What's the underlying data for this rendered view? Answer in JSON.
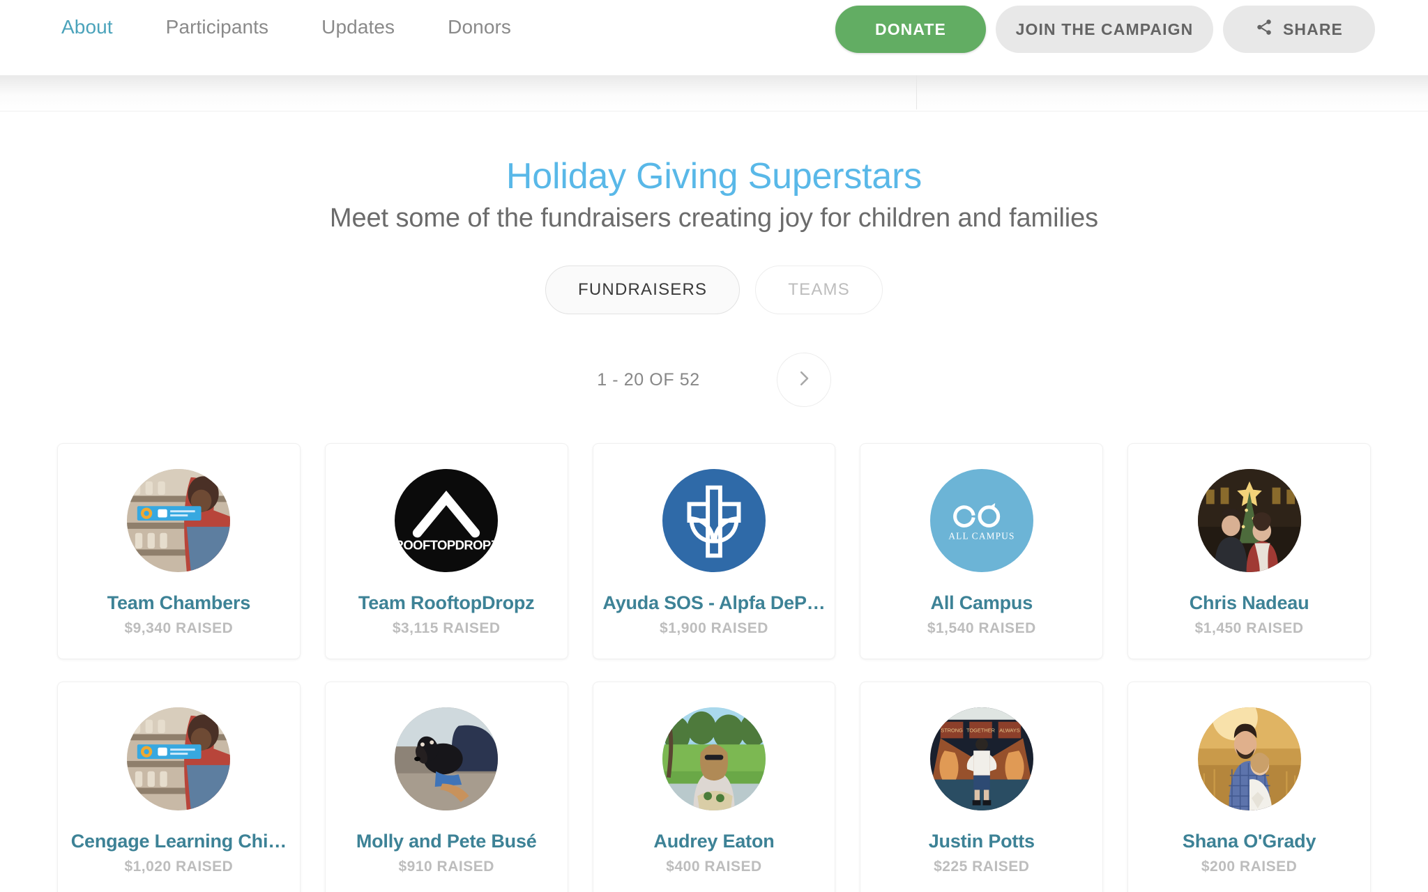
{
  "nav": {
    "tabs": [
      {
        "label": "About",
        "active": true
      },
      {
        "label": "Participants",
        "active": false
      },
      {
        "label": "Updates",
        "active": false
      },
      {
        "label": "Donors",
        "active": false
      }
    ]
  },
  "actions": {
    "donate": "DONATE",
    "join": "JOIN THE CAMPAIGN",
    "share": "SHARE"
  },
  "colors": {
    "accent_teal": "#4ba3bb",
    "title_blue": "#59b8e8",
    "donate_green": "#62ad63",
    "link_teal": "#3d8296"
  },
  "main": {
    "title": "Holiday Giving Superstars",
    "subtitle": "Meet some of the fundraisers creating joy for children and families",
    "toggles": [
      {
        "label": "FUNDRAISERS",
        "active": true
      },
      {
        "label": "TEAMS",
        "active": false
      }
    ],
    "pager": {
      "count_label": "1 - 20 OF 52",
      "next_icon": "chevron-right-icon"
    }
  },
  "fundraisers": [
    {
      "name": "Team Chambers",
      "amount": "$9,340 RAISED",
      "avatar": "photo-store"
    },
    {
      "name": "Team RooftopDropz",
      "amount": "$3,115 RAISED",
      "avatar": "logo-rooftopdropz"
    },
    {
      "name": "Ayuda SOS - Alpfa DeP…",
      "amount": "$1,900 RAISED",
      "avatar": "logo-ayuda"
    },
    {
      "name": "All Campus",
      "amount": "$1,540 RAISED",
      "avatar": "logo-allcampus"
    },
    {
      "name": "Chris Nadeau",
      "amount": "$1,450 RAISED",
      "avatar": "photo-couple-tree"
    },
    {
      "name": "Cengage Learning Chi…",
      "amount": "$1,020 RAISED",
      "avatar": "photo-store"
    },
    {
      "name": "Molly and Pete Busé",
      "amount": "$910 RAISED",
      "avatar": "photo-dog"
    },
    {
      "name": "Audrey Eaton",
      "amount": "$400 RAISED",
      "avatar": "photo-park"
    },
    {
      "name": "Justin Potts",
      "amount": "$225 RAISED",
      "avatar": "photo-mural"
    },
    {
      "name": "Shana O'Grady",
      "amount": "$200 RAISED",
      "avatar": "photo-field"
    }
  ]
}
